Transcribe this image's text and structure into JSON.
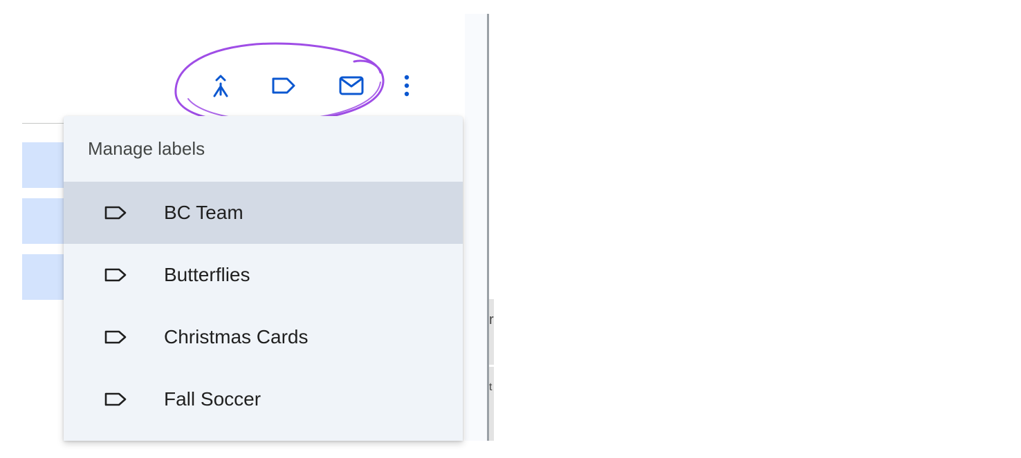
{
  "toolbar": {
    "buttons": [
      {
        "icon": "merge-icon"
      },
      {
        "icon": "label-icon"
      },
      {
        "icon": "mail-icon"
      },
      {
        "icon": "more-vert-icon"
      }
    ],
    "accent_color": "#0b57d0",
    "annotation_color": "#9f4de6"
  },
  "menu": {
    "header": "Manage labels",
    "items": [
      {
        "label": "BC Team",
        "icon": "label-outline-icon",
        "highlighted": true
      },
      {
        "label": "Butterflies",
        "icon": "label-outline-icon"
      },
      {
        "label": "Christmas Cards",
        "icon": "label-outline-icon"
      },
      {
        "label": "Fall Soccer",
        "icon": "label-outline-icon"
      }
    ]
  },
  "peek": {
    "char_1": "r",
    "char_2": "t"
  },
  "colors": {
    "menu_bg": "#f0f4f9",
    "menu_selected": "#d3dae5",
    "row_selected": "#d3e3fd"
  }
}
